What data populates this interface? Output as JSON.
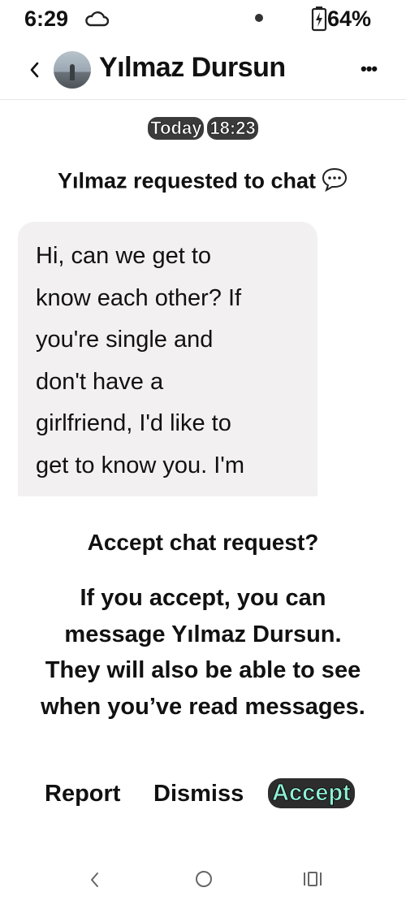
{
  "status_bar": {
    "time": "6:29",
    "battery": "64%",
    "icons": [
      "cloud-icon",
      "dot-indicator",
      "battery-charging-icon"
    ]
  },
  "header": {
    "contact_name": "Yılmaz Dursun",
    "icons": [
      "back-chevron-icon",
      "avatar",
      "more-dots-icon"
    ]
  },
  "timestamp": {
    "day": "Today",
    "time": "18:23"
  },
  "request_label": "Yılmaz requested to chat",
  "message": {
    "lines": [
      "Hi, can we get to",
      "know each other? If",
      "you're single and",
      "don't have a",
      "girlfriend, I'd like to",
      "get to know you. I'm"
    ]
  },
  "prompt": {
    "title": "Accept chat request?",
    "body_lines": [
      "If you accept, you can",
      "message Yılmaz Dursun.",
      "They will also be able to see",
      "when you’ve read messages."
    ]
  },
  "actions": {
    "report": "Report",
    "dismiss": "Dismiss",
    "accept": "Accept"
  },
  "colors": {
    "accept_text": "#8ff0d6",
    "chip_bg": "#3b3b3b",
    "bubble_bg": "#f2f0f0"
  }
}
